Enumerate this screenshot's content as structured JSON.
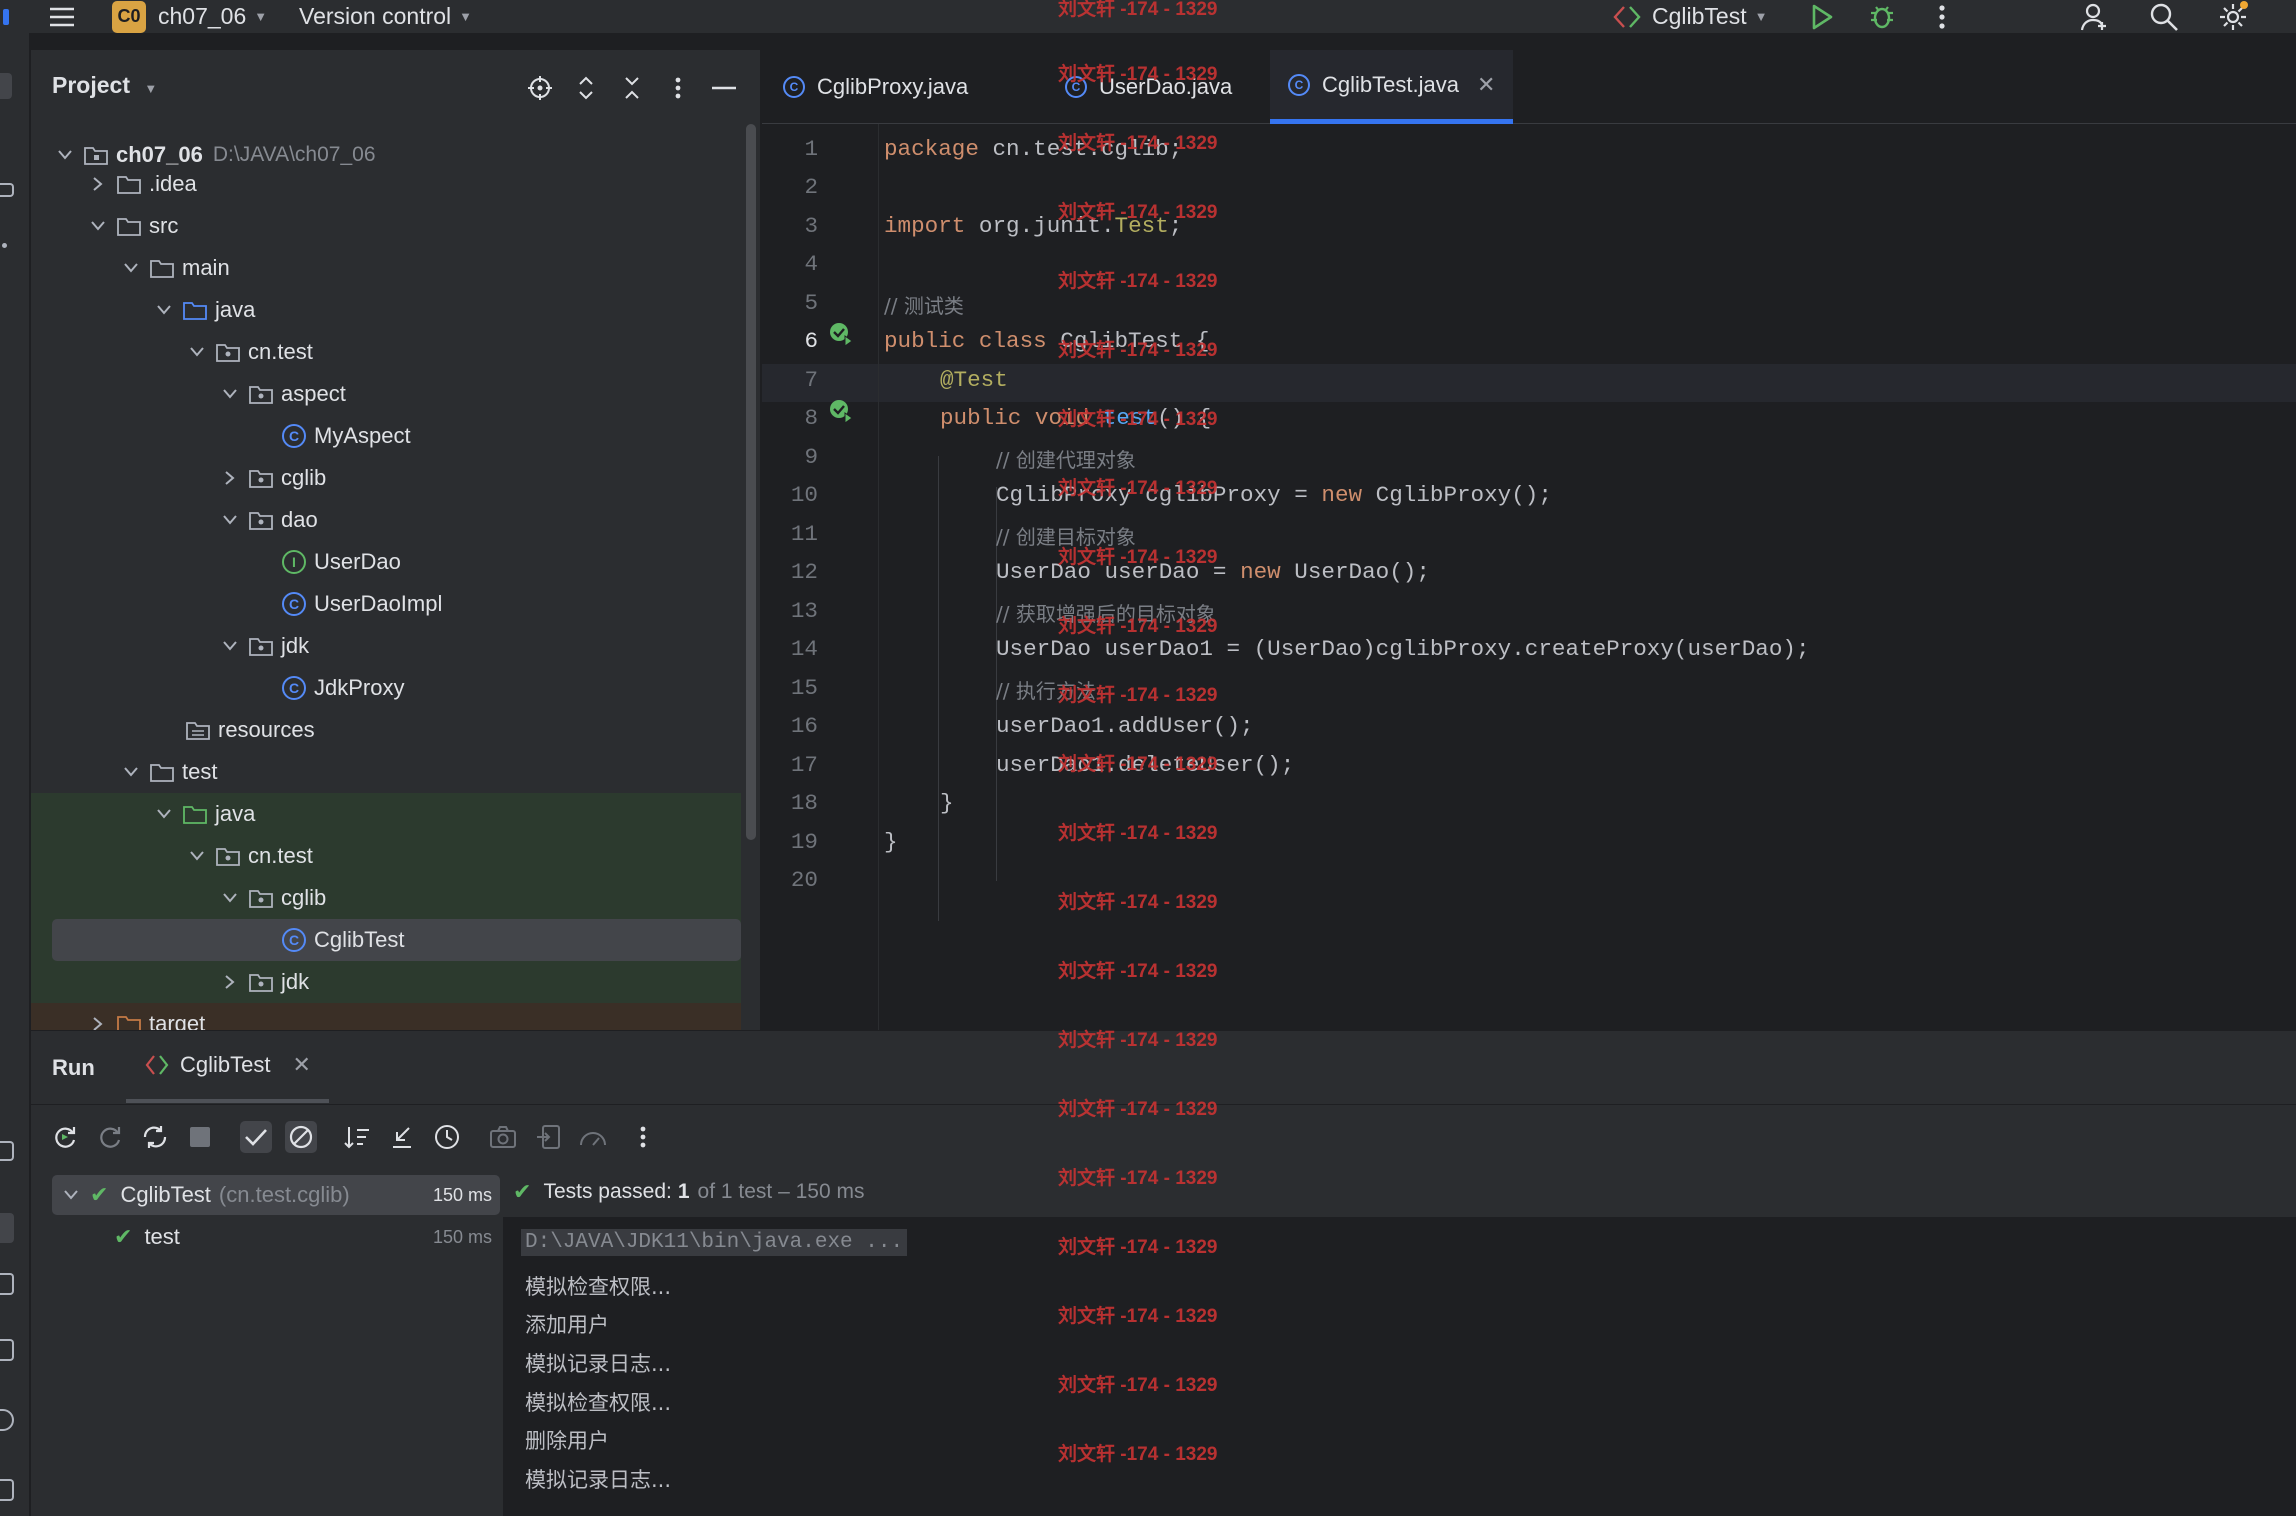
{
  "topbar": {
    "project_badge": "C0",
    "project_name": "ch07_06",
    "vcs": "Version control",
    "run_config": "CglibTest"
  },
  "project_panel": {
    "title": "Project",
    "tree": [
      {
        "label": "ch07_06",
        "hint": "D:\\JAVA\\ch07_06"
      },
      {
        "label": ".idea"
      },
      {
        "label": "src"
      },
      {
        "label": "main"
      },
      {
        "label": "java"
      },
      {
        "label": "cn.test"
      },
      {
        "label": "aspect"
      },
      {
        "label": "MyAspect"
      },
      {
        "label": "cglib"
      },
      {
        "label": "dao"
      },
      {
        "label": "UserDao"
      },
      {
        "label": "UserDaoImpl"
      },
      {
        "label": "jdk"
      },
      {
        "label": "JdkProxy"
      },
      {
        "label": "resources"
      },
      {
        "label": "test"
      },
      {
        "label": "java"
      },
      {
        "label": "cn.test"
      },
      {
        "label": "cglib"
      },
      {
        "label": "CglibTest"
      },
      {
        "label": "jdk"
      },
      {
        "label": "target"
      }
    ]
  },
  "editor": {
    "tabs": [
      {
        "label": "CglibProxy.java"
      },
      {
        "label": "UserDao.java"
      },
      {
        "label": "CglibTest.java"
      }
    ],
    "active_tab": "CglibTest.java",
    "line_numbers": [
      "1",
      "2",
      "3",
      "4",
      "5",
      "6",
      "7",
      "8",
      "9",
      "10",
      "11",
      "12",
      "13",
      "14",
      "15",
      "16",
      "17",
      "18",
      "19",
      "20"
    ],
    "code": {
      "l1_kw": "package",
      "l1_rest": " cn.test.cglib;",
      "l3_kw": "import",
      "l3_rest": " org.junit.",
      "l3_ann": "Test",
      "l3_end": ";",
      "l5": "// 测试类",
      "l6_kw": "public class",
      "l6_rest": " CglibTest {",
      "l7": "@Test",
      "l8_kw": "public void",
      "l8_fn": "test",
      "l8_rest": "() {",
      "l9": "// 创建代理对象",
      "l10_a": "CglibProxy cglibProxy = ",
      "l10_kw": "new",
      "l10_b": " CglibProxy();",
      "l11": "// 创建目标对象",
      "l12_a": "UserDao userDao = ",
      "l12_kw": "new",
      "l12_b": " UserDao();",
      "l13": "// 获取增强后的目标对象",
      "l14": "UserDao userDao1 = (UserDao)cglibProxy.createProxy(userDao);",
      "l15": "// 执行方法",
      "l16": "userDao1.addUser();",
      "l17": "userDao1.deleteUser();",
      "l18": "}",
      "l19": "}"
    }
  },
  "watermark": "刘文轩 -174 - 1329",
  "run_panel": {
    "title": "Run",
    "tab": "CglibTest",
    "tests": [
      {
        "name": "CglibTest",
        "pkg": "(cn.test.cglib)",
        "time": "150 ms"
      },
      {
        "name": "test",
        "time": "150 ms"
      }
    ],
    "status_prefix": "Tests passed: ",
    "status_count": "1",
    "status_suffix": " of 1 test – 150 ms",
    "console": [
      "D:\\JAVA\\JDK11\\bin\\java.exe ...",
      "模拟检查权限...",
      "添加用户",
      "模拟记录日志...",
      "模拟检查权限...",
      "删除用户",
      "模拟记录日志..."
    ]
  },
  "colors": {
    "accent": "#3574f0",
    "success": "#5fb865",
    "watermark": "#c93333",
    "keyword": "#cf8e6d",
    "annotation": "#b3ae60"
  }
}
